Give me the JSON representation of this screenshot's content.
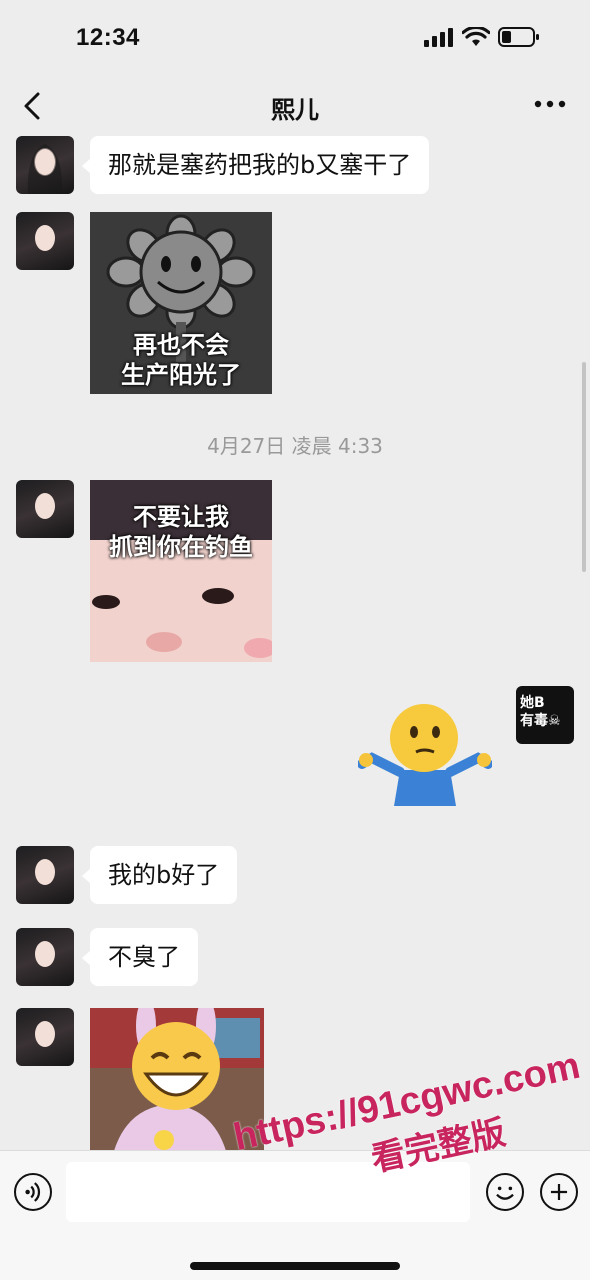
{
  "status_bar": {
    "time": "12:34"
  },
  "nav": {
    "title": "熙儿"
  },
  "messages": [
    {
      "type": "text",
      "text": "那就是塞药把我的b又塞干了"
    },
    {
      "type": "sticker",
      "caption_lines": [
        "再也不会",
        "生产阳光了"
      ],
      "icon": "sunflower-sticker"
    },
    {
      "type": "timestamp",
      "text": "4月27日 凌晨 4:33"
    },
    {
      "type": "sticker",
      "caption_lines": [
        "不要让我",
        "抓到你在钓鱼"
      ],
      "icon": "baby-face-sticker"
    },
    {
      "type": "sent-sticker",
      "icon": "shrug-emoji-sticker",
      "avatar_lines": [
        "她B",
        "有毒☠"
      ]
    },
    {
      "type": "text",
      "text": "我的b好了"
    },
    {
      "type": "text",
      "text": "不臭了"
    },
    {
      "type": "sticker",
      "caption_lines": [],
      "icon": "laughing-bunny-sticker"
    }
  ],
  "input_bar": {
    "placeholder": ""
  },
  "watermark": {
    "line1": "https://91cgwc.com",
    "line2": "看完整版"
  },
  "colors": {
    "background": "#ededed",
    "bubble": "#ffffff",
    "watermark": "#c8245e",
    "timestamp": "#999999"
  }
}
